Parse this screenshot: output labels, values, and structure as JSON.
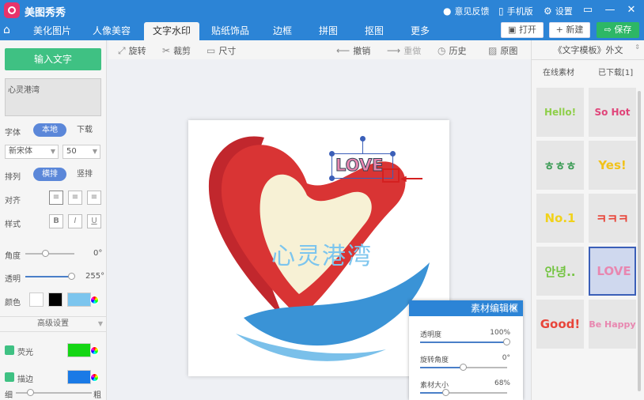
{
  "app": {
    "title": "美图秀秀"
  },
  "titlebar": {
    "feedback": "意见反馈",
    "mobile": "手机版",
    "settings": "设置"
  },
  "tabs": [
    "美化图片",
    "人像美容",
    "文字水印",
    "贴纸饰品",
    "边框",
    "拼图",
    "抠图",
    "更多"
  ],
  "header_buttons": {
    "open": "打开",
    "new": "+ 新建",
    "save": "保存"
  },
  "left": {
    "input_button": "输入文字",
    "text_value": "心灵港湾",
    "font_label": "字体",
    "font_local": "本地",
    "font_download": "下载",
    "font_name": "新宋体",
    "font_size": "50",
    "layout_label": "排列",
    "layout_horizontal": "横排",
    "layout_vertical": "竖排",
    "align_label": "对齐",
    "style_label": "样式",
    "style_bold": "B",
    "style_italic": "I",
    "style_underline": "U",
    "angle_label": "角度",
    "angle_value": "0°",
    "opacity_label": "透明",
    "opacity_value": "255°",
    "color_label": "颜色",
    "advanced": "高级设置",
    "glow_label": "荧光",
    "stroke_label": "描边",
    "thin": "细",
    "thick": "粗",
    "angle_fraction": 0.42,
    "opacity_fraction": 0.95
  },
  "toolbar": {
    "rotate": "旋转",
    "crop": "裁剪",
    "size": "尺寸",
    "undo": "撤销",
    "redo": "重做",
    "history": "历史",
    "original": "原图"
  },
  "canvas": {
    "watermark_text": "心灵港湾",
    "sticker_text": "LOVE"
  },
  "dialog": {
    "title": "素材编辑框",
    "opacity_label": "透明度",
    "opacity_value": "100%",
    "rotate_label": "旋转角度",
    "rotate_value": "0°",
    "size_label": "素材大小",
    "size_value": "68%",
    "opacity_fraction": 1.0,
    "rotate_fraction": 0.5,
    "size_fraction": 0.3
  },
  "right": {
    "category": "《文字模板》外文",
    "tab_online": "在线素材",
    "tab_downloaded": "已下载[1]",
    "stickers": [
      "Hello!",
      "So Hot",
      "ㅎㅎㅎ",
      "Yes!",
      "No.1",
      "ㅋㅋㅋ",
      "안녕..",
      "LOVE",
      "Good!",
      "Be Happy"
    ]
  },
  "colors": {
    "titlebar": "#2c84d6",
    "accent_green": "#3fc183",
    "text_color": "#7cc5ee",
    "glow": "#14d614",
    "stroke": "#1a7ae6"
  }
}
